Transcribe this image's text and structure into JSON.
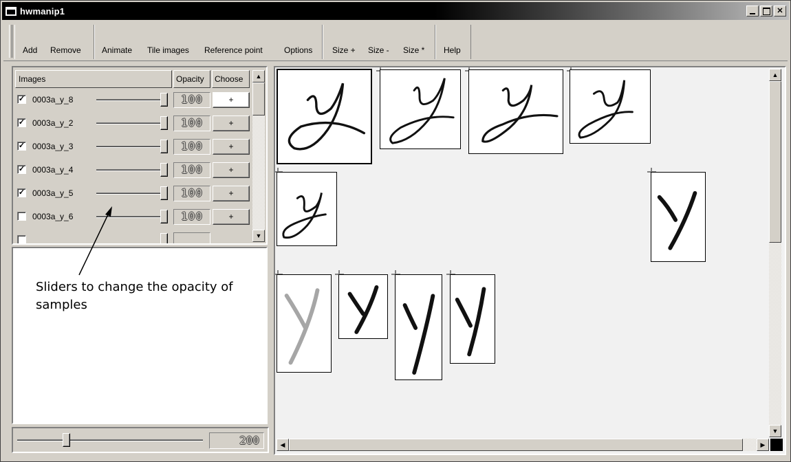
{
  "window": {
    "title": "hwmanip1"
  },
  "toolbar": {
    "groups": [
      [
        "Add",
        "Remove"
      ],
      [
        "Animate",
        "Tile images",
        "Reference point",
        "Options"
      ],
      [
        "Size +",
        "Size -",
        "Size *"
      ],
      [
        "Help"
      ]
    ]
  },
  "image_list": {
    "headers": {
      "images": "Images",
      "opacity": "Opacity",
      "choose": "Choose"
    },
    "rows": [
      {
        "name": "0003a_y_8",
        "checked": true,
        "opacity": "100",
        "choose": "+"
      },
      {
        "name": "0003a_y_2",
        "checked": true,
        "opacity": "100",
        "choose": "+"
      },
      {
        "name": "0003a_y_3",
        "checked": true,
        "opacity": "100",
        "choose": "+"
      },
      {
        "name": "0003a_y_4",
        "checked": true,
        "opacity": "100",
        "choose": "+"
      },
      {
        "name": "0003a_y_5",
        "checked": true,
        "opacity": "100",
        "choose": "+"
      },
      {
        "name": "0003a_y_6",
        "checked": false,
        "opacity": "100",
        "choose": "+"
      }
    ]
  },
  "size_slider": {
    "value": "200"
  },
  "annotation": {
    "text": "Sliders to change the opacity of samples"
  },
  "colors": {
    "title_bar": "#000000",
    "face": "#d4d0c8",
    "canvas": "#f1f1f1"
  }
}
